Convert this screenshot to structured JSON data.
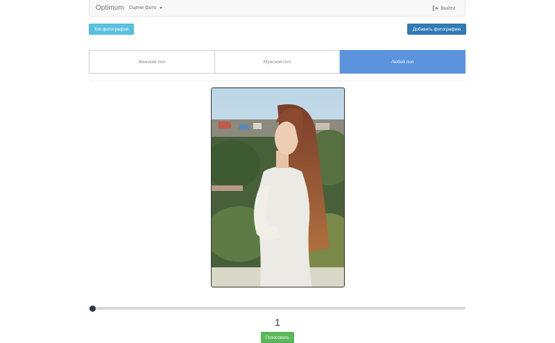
{
  "navbar": {
    "brand": "Optimum",
    "menu_label": "Оцени фото",
    "logout_label": "Выйти"
  },
  "actions": {
    "top_photos": "Топ фотографий",
    "add_photo": "Добавить фотографию"
  },
  "gender_filter": {
    "options": [
      "Женский пол",
      "Мужской пол",
      "Любой пол"
    ],
    "selected": "Любой пол"
  },
  "rating": {
    "value": "1",
    "vote_label": "Голосовать"
  },
  "colors": {
    "info": "#5bc0de",
    "primary": "#337ab7",
    "active_segment": "#5b93dd",
    "success": "#5cb85c"
  }
}
